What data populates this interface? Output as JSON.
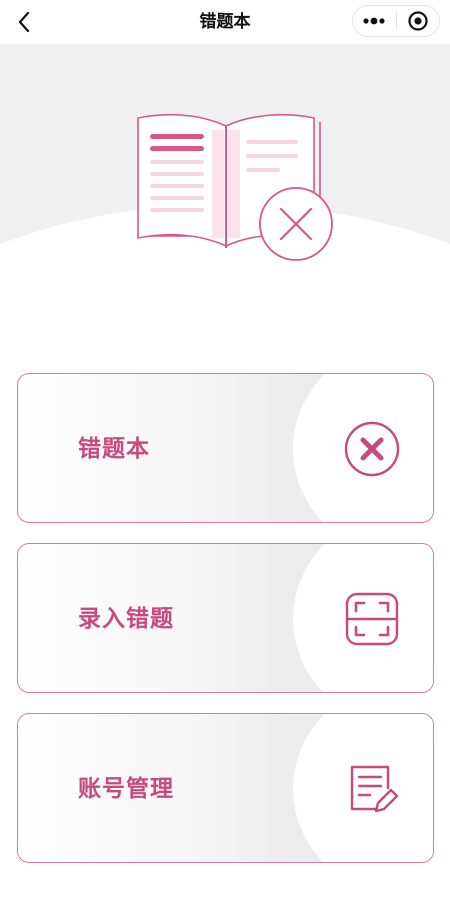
{
  "navbar": {
    "title": "错题本",
    "back_icon": "chevron-left-icon",
    "more_icon": "more-dots-icon",
    "close_icon": "target-close-icon"
  },
  "hero": {
    "illustration_icon": "wrong-answer-book-icon",
    "background_color": "#f0f0f0",
    "accent_color": "#d8578b"
  },
  "menu": {
    "items": [
      {
        "label": "错题本",
        "icon": "wrong-x-icon"
      },
      {
        "label": "录入错题",
        "icon": "scan-icon"
      },
      {
        "label": "账号管理",
        "icon": "edit-note-icon"
      }
    ]
  },
  "colors": {
    "accent": "#c8497e",
    "border": "#d87aa0"
  }
}
